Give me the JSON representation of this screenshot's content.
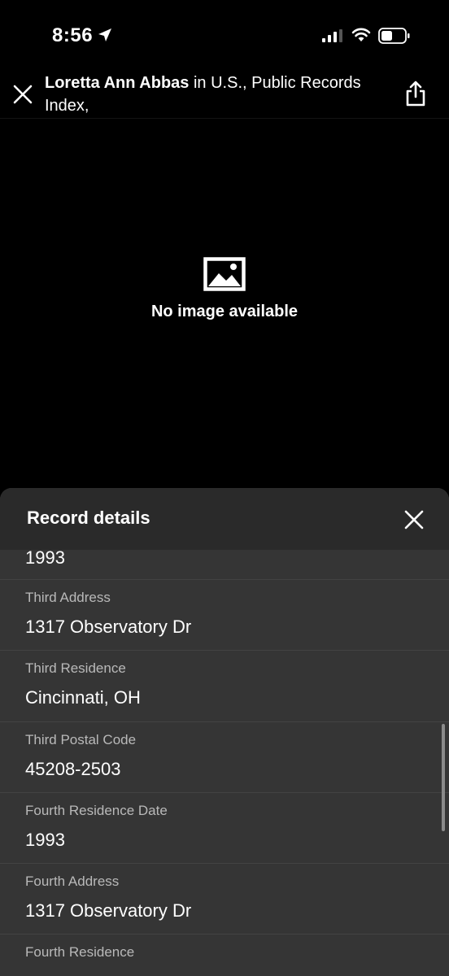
{
  "status": {
    "time": "8:56"
  },
  "header": {
    "name": "Loretta Ann Abbas",
    "collection": " in U.S., Public Records Index,"
  },
  "viewer": {
    "no_image_text": "No image available"
  },
  "sheet": {
    "title": "Record details",
    "top_value": "1993",
    "fields": [
      {
        "label": "Third Address",
        "value": "1317 Observatory Dr"
      },
      {
        "label": "Third Residence",
        "value": "Cincinnati, OH"
      },
      {
        "label": "Third Postal Code",
        "value": "45208-2503"
      },
      {
        "label": "Fourth Residence Date",
        "value": "1993"
      },
      {
        "label": "Fourth Address",
        "value": "1317 Observatory Dr"
      },
      {
        "label": "Fourth Residence",
        "value": ""
      }
    ]
  }
}
